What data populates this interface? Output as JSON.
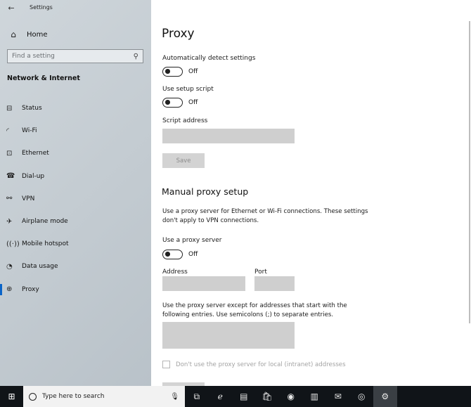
{
  "window": {
    "title": "Settings"
  },
  "sidebar": {
    "home_label": "Home",
    "search_placeholder": "Find a setting",
    "section_title": "Network & Internet",
    "items": [
      {
        "label": "Status",
        "icon": "status-icon",
        "glyph": "⊟"
      },
      {
        "label": "Wi-Fi",
        "icon": "wifi-icon",
        "glyph": "◜"
      },
      {
        "label": "Ethernet",
        "icon": "ethernet-icon",
        "glyph": "⊡"
      },
      {
        "label": "Dial-up",
        "icon": "dialup-icon",
        "glyph": "☎"
      },
      {
        "label": "VPN",
        "icon": "vpn-icon",
        "glyph": "⚯"
      },
      {
        "label": "Airplane mode",
        "icon": "airplane-icon",
        "glyph": "✈"
      },
      {
        "label": "Mobile hotspot",
        "icon": "hotspot-icon",
        "glyph": "((·))"
      },
      {
        "label": "Data usage",
        "icon": "data-usage-icon",
        "glyph": "◔"
      },
      {
        "label": "Proxy",
        "icon": "globe-icon",
        "glyph": "⊕",
        "active": true
      }
    ]
  },
  "content": {
    "title": "Proxy",
    "auto_detect": {
      "label": "Automatically detect settings",
      "state": "Off"
    },
    "setup_script": {
      "label": "Use setup script",
      "state": "Off"
    },
    "script_address": {
      "label": "Script address",
      "value": ""
    },
    "save_label": "Save",
    "manual": {
      "title": "Manual proxy setup",
      "description": "Use a proxy server for Ethernet or Wi-Fi connections. These settings don't apply to VPN connections.",
      "use_proxy": {
        "label": "Use a proxy server",
        "state": "Off"
      },
      "address_label": "Address",
      "port_label": "Port",
      "exceptions_text": "Use the proxy server except for addresses that start with the following entries. Use semicolons (;) to separate entries.",
      "local_checkbox_label": "Don't use the proxy server for local (intranet) addresses"
    }
  },
  "taskbar": {
    "search_placeholder": "Type here to search",
    "icons": [
      {
        "name": "task-view-icon",
        "glyph": "⧉"
      },
      {
        "name": "edge-icon",
        "glyph": "ℯ"
      },
      {
        "name": "file-explorer-icon",
        "glyph": "▤"
      },
      {
        "name": "store-icon",
        "glyph": "🛍"
      },
      {
        "name": "firefox-icon",
        "glyph": "◉"
      },
      {
        "name": "app-icon",
        "glyph": "▥"
      },
      {
        "name": "mail-icon",
        "glyph": "✉"
      },
      {
        "name": "chrome-icon",
        "glyph": "◎"
      },
      {
        "name": "settings-icon",
        "glyph": "⚙",
        "active": true
      }
    ]
  }
}
